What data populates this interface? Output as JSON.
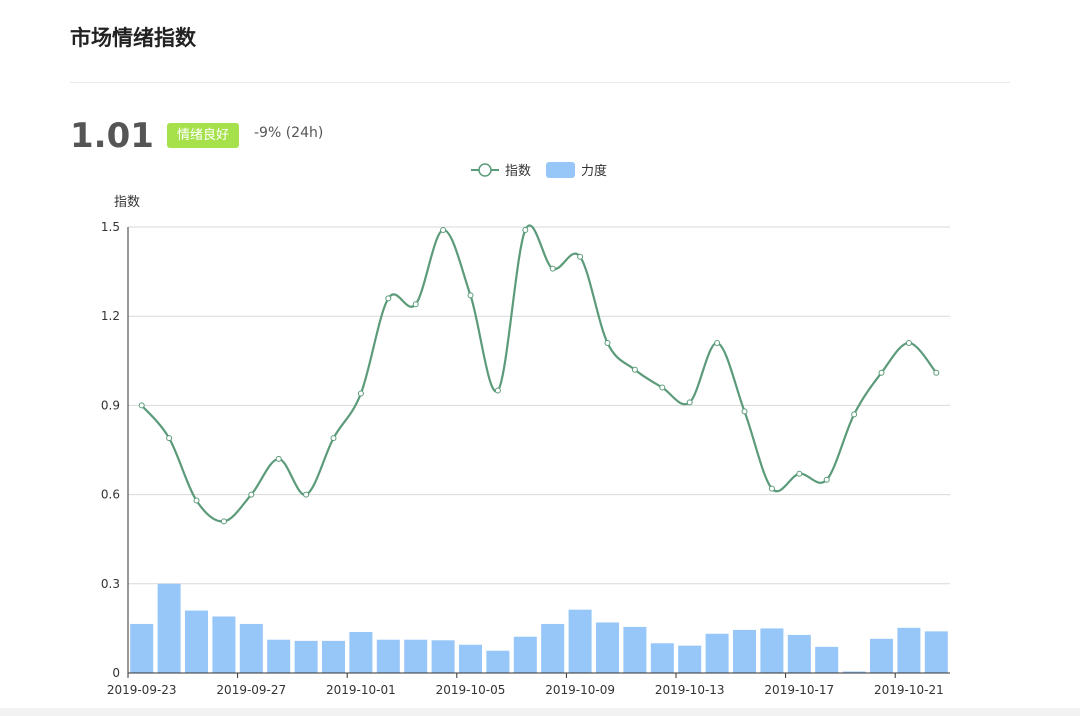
{
  "page": {
    "title": "市场情绪指数",
    "value": "1.01",
    "badge": "情绪良好",
    "change": "-9% (24h)"
  },
  "colors": {
    "line": "#5b9b7a",
    "bar": "#97c6f8",
    "badge": "#a6e14c"
  },
  "chart_data": {
    "type": "line+bar",
    "ylabel": "指数",
    "ylim": [
      0,
      1.5
    ],
    "yticks": [
      "0",
      "0.3",
      "0.6",
      "0.9",
      "1.2",
      "1.5"
    ],
    "grid": true,
    "legend": "top-center",
    "x": [
      "2019-09-23",
      "2019-09-24",
      "2019-09-25",
      "2019-09-26",
      "2019-09-27",
      "2019-09-28",
      "2019-09-29",
      "2019-09-30",
      "2019-10-01",
      "2019-10-02",
      "2019-10-03",
      "2019-10-04",
      "2019-10-05",
      "2019-10-06",
      "2019-10-07",
      "2019-10-08",
      "2019-10-09",
      "2019-10-10",
      "2019-10-11",
      "2019-10-12",
      "2019-10-13",
      "2019-10-14",
      "2019-10-15",
      "2019-10-16",
      "2019-10-17",
      "2019-10-18",
      "2019-10-19",
      "2019-10-20",
      "2019-10-21",
      "2019-10-22"
    ],
    "xtick_labels": [
      "2019-09-23",
      "2019-09-27",
      "2019-10-01",
      "2019-10-05",
      "2019-10-09",
      "2019-10-13",
      "2019-10-17",
      "2019-10-21"
    ],
    "series": [
      {
        "name": "指数",
        "type": "line",
        "values": [
          0.9,
          0.79,
          0.58,
          0.51,
          0.6,
          0.72,
          0.6,
          0.79,
          0.94,
          1.26,
          1.24,
          1.49,
          1.27,
          0.95,
          1.49,
          1.36,
          1.4,
          1.11,
          1.02,
          0.96,
          0.91,
          1.11,
          0.88,
          0.62,
          0.67,
          0.65,
          0.87,
          1.01,
          1.11,
          1.01
        ]
      },
      {
        "name": "力度",
        "type": "bar",
        "values": [
          0.165,
          0.3,
          0.21,
          0.19,
          0.165,
          0.112,
          0.108,
          0.108,
          0.138,
          0.112,
          0.112,
          0.11,
          0.095,
          0.075,
          0.122,
          0.165,
          0.213,
          0.17,
          0.155,
          0.1,
          0.092,
          0.132,
          0.145,
          0.15,
          0.128,
          0.088,
          0.005,
          0.115,
          0.152,
          0.14
        ]
      }
    ]
  }
}
